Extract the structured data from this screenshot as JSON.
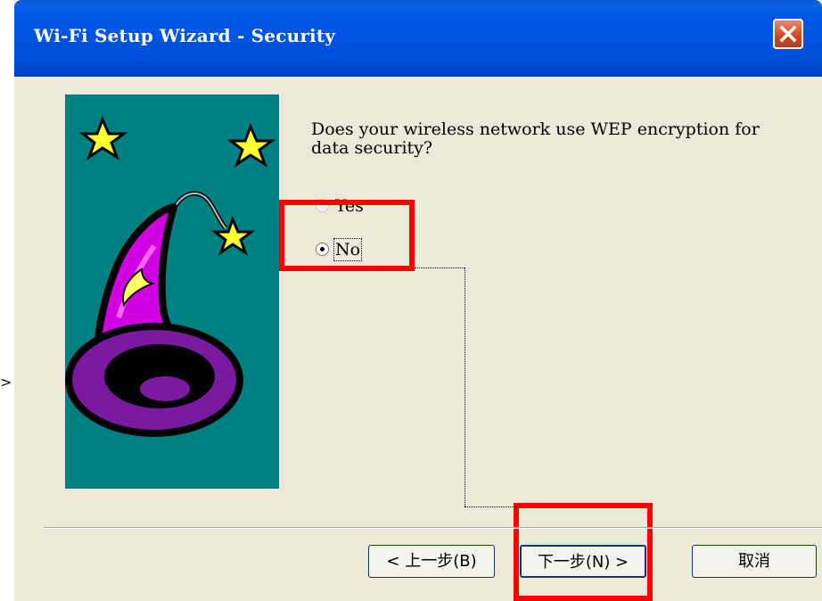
{
  "window": {
    "title": "Wi-Fi Setup Wizard - Security"
  },
  "question": "Does your wireless network use WEP encryption for data security?",
  "options": [
    {
      "label": "Yes",
      "checked": false,
      "enabled": false
    },
    {
      "label": "No",
      "checked": true,
      "enabled": true
    }
  ],
  "buttons": {
    "back": "< 上一步(B)",
    "next": "下一步(N) >",
    "cancel": "取消"
  },
  "colors": {
    "titlebar": "#0058e6",
    "dialog_bg": "#ece9d8",
    "art_bg": "#008080",
    "annotation": "#ff0000"
  }
}
